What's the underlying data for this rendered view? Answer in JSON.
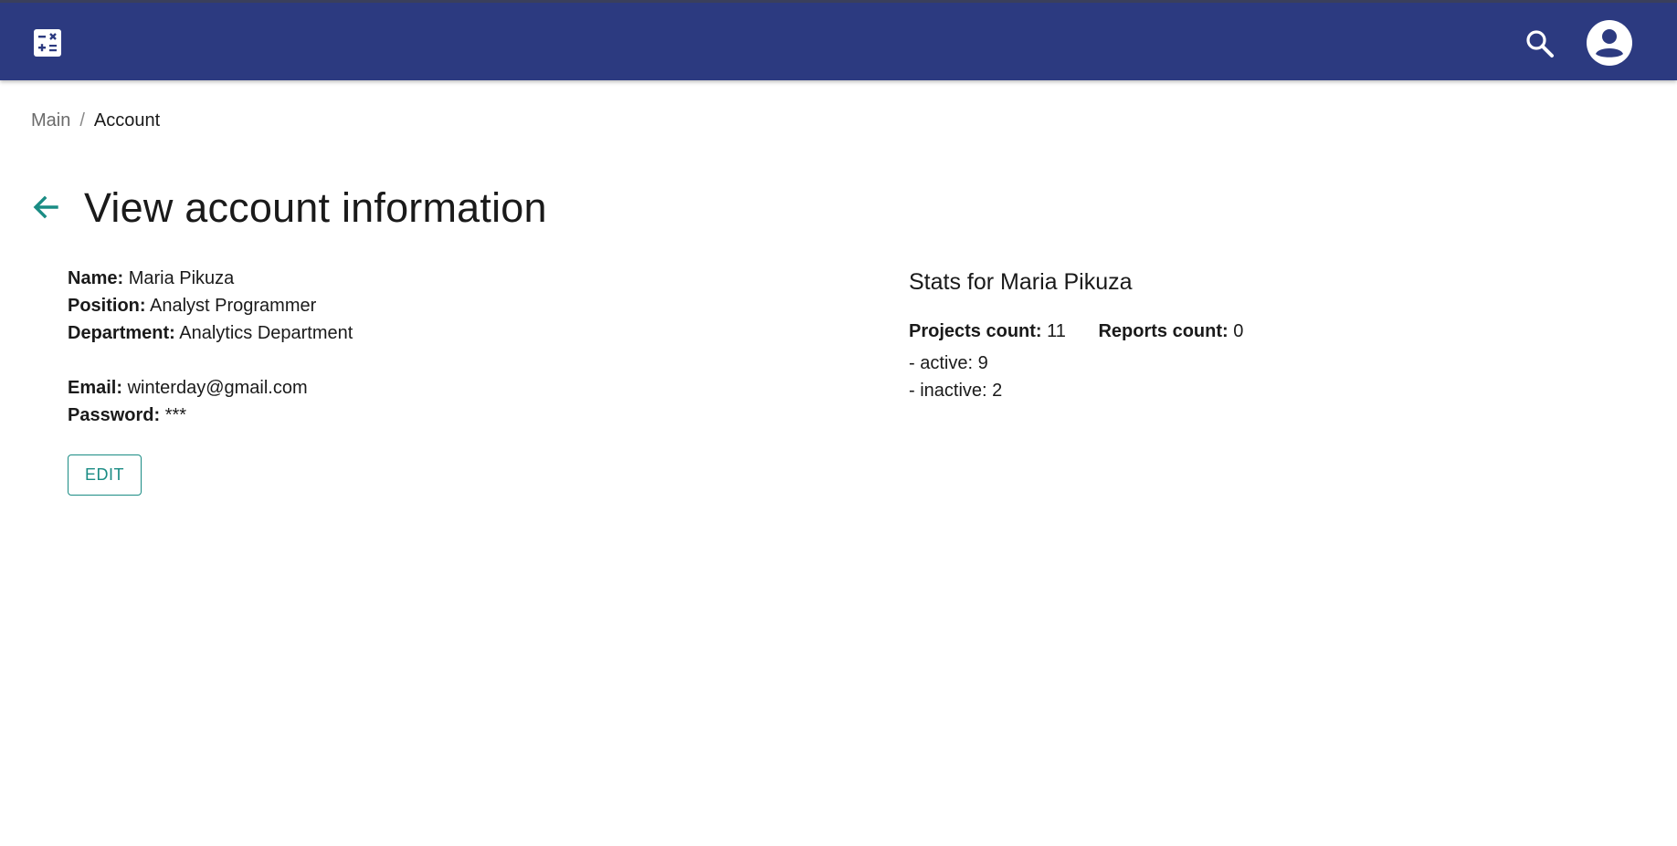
{
  "appbar": {
    "logo_icon": "calculator-icon",
    "search_icon": "search-icon",
    "account_icon": "account-circle-icon",
    "background": "#2c3a80"
  },
  "breadcrumb": {
    "items": [
      "Main",
      "Account"
    ],
    "separator": "/"
  },
  "page": {
    "back_icon": "arrow-back-icon",
    "title": "View account information",
    "accent": "#1a8c84"
  },
  "account": {
    "name_label": "Name:",
    "name": "Maria Pikuza",
    "position_label": "Position:",
    "position": "Analyst Programmer",
    "department_label": "Department:",
    "department": "Analytics Department",
    "email_label": "Email:",
    "email": "winterday@gmail.com",
    "password_label": "Password:",
    "password": "***",
    "edit_label": "EDIT"
  },
  "stats": {
    "title": "Stats for Maria Pikuza",
    "projects_label": "Projects count:",
    "projects_count": "11",
    "reports_label": "Reports count:",
    "reports_count": "0",
    "active_text": "- active: 9",
    "inactive_text": "- inactive: 2"
  }
}
